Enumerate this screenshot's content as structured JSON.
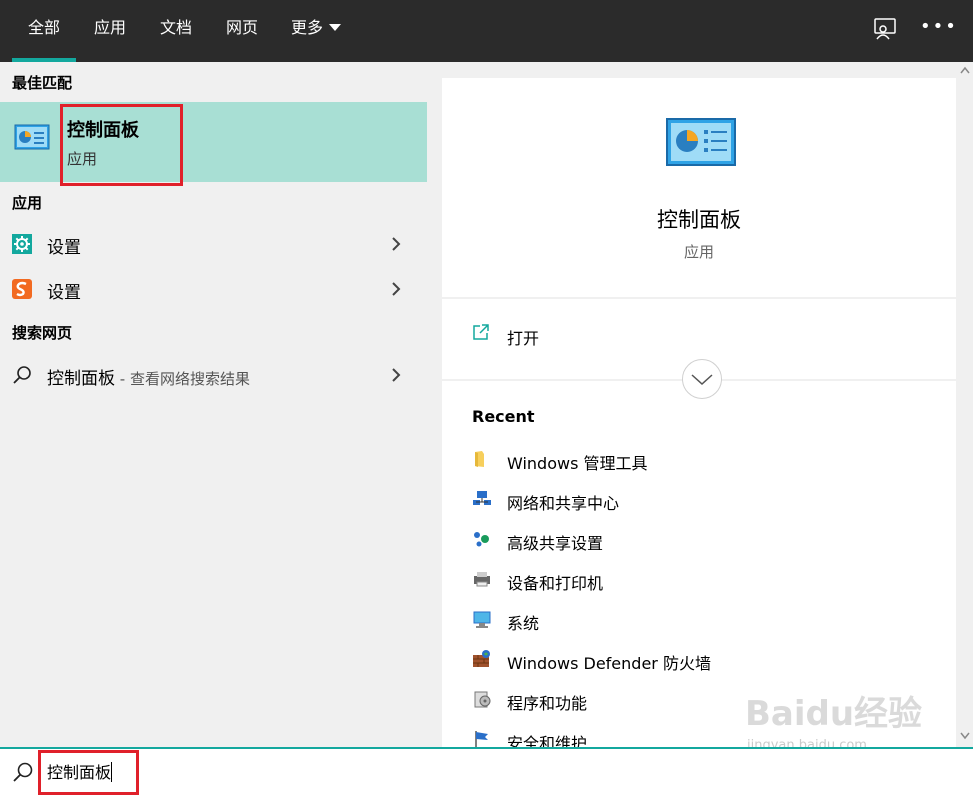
{
  "tabs": [
    {
      "label": "全部",
      "active": true
    },
    {
      "label": "应用"
    },
    {
      "label": "文档"
    },
    {
      "label": "网页"
    },
    {
      "label": "更多"
    }
  ],
  "left": {
    "best_match_heading": "最佳匹配",
    "best_match": {
      "title": "控制面板",
      "subtitle": "应用"
    },
    "apps_heading": "应用",
    "apps": [
      {
        "label": "设置",
        "icon": "gear-icon"
      },
      {
        "label": "设置",
        "icon": "sogou-icon"
      }
    ],
    "web_heading": "搜索网页",
    "web_result": {
      "label": "控制面板",
      "suffix": " - 查看网络搜索结果"
    }
  },
  "right": {
    "title": "控制面板",
    "subtitle": "应用",
    "open_label": "打开",
    "recent_heading": "Recent",
    "recent": [
      {
        "label": "Windows 管理工具",
        "icon": "folder-icon"
      },
      {
        "label": "网络和共享中心",
        "icon": "network-icon"
      },
      {
        "label": "高级共享设置",
        "icon": "sharing-icon"
      },
      {
        "label": "设备和打印机",
        "icon": "printer-icon"
      },
      {
        "label": "系统",
        "icon": "system-icon"
      },
      {
        "label": "Windows Defender 防火墙",
        "icon": "firewall-icon"
      },
      {
        "label": "程序和功能",
        "icon": "programs-icon"
      },
      {
        "label": "安全和维护",
        "icon": "flag-icon"
      }
    ]
  },
  "search": {
    "value": "控制面板"
  },
  "watermark": {
    "text": "Baidu经验",
    "sub": "jingyan.baidu.com"
  },
  "colors": {
    "accent": "#13a89e",
    "highlight": "#a8dfd4",
    "annotation": "#e0202a",
    "topbar": "#2b2b2b"
  }
}
